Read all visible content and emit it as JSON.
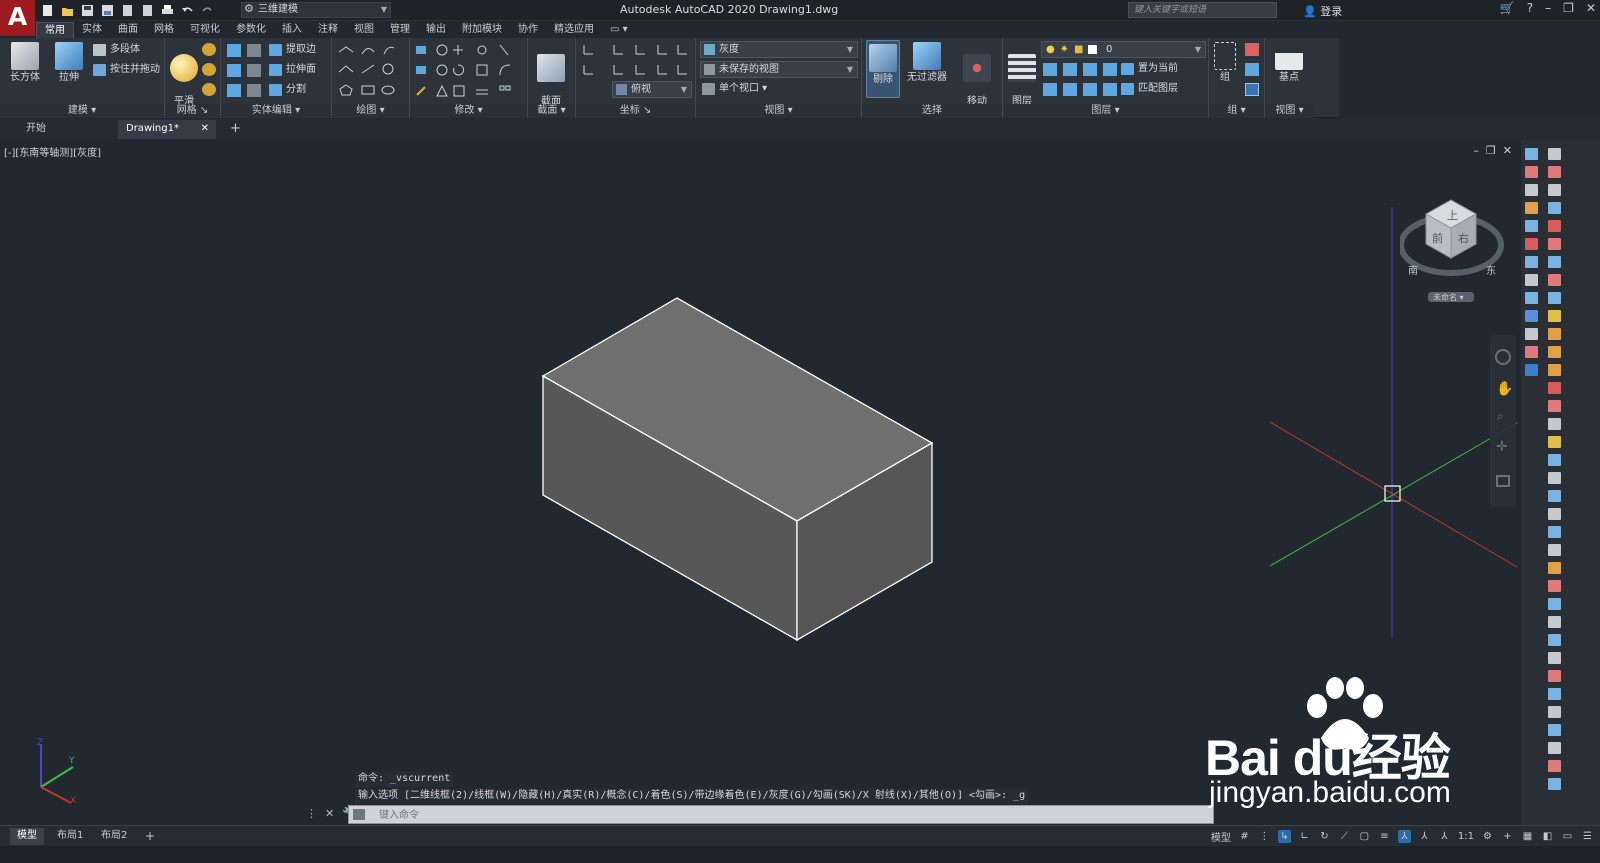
{
  "app": {
    "logo_letter": "A",
    "title": "Autodesk AutoCAD 2020    Drawing1.dwg",
    "workspace": "三维建模",
    "search_placeholder": "键入关键字或短语",
    "login": "登录"
  },
  "ribbon_tabs": [
    "常用",
    "实体",
    "曲面",
    "网格",
    "可视化",
    "参数化",
    "插入",
    "注释",
    "视图",
    "管理",
    "输出",
    "附加模块",
    "协作",
    "精选应用"
  ],
  "ribbon": {
    "modeling": {
      "title": "建模 ▾",
      "box": "长方体",
      "extrude": "拉伸",
      "polysolid": "多段体",
      "presspull": "按住并拖动"
    },
    "mesh": {
      "title": "网格 ↘",
      "smooth": "平滑\n对象"
    },
    "solid_edit": {
      "title": "实体编辑 ▾",
      "extract_edges": "提取边",
      "extrude_faces": "拉伸面",
      "separate": "分割"
    },
    "draw": {
      "title": "绘图 ▾"
    },
    "modify": {
      "title": "修改 ▾"
    },
    "section": {
      "title": "截面 ▾",
      "section_plane": "截面\n平面"
    },
    "coordinates": {
      "title": "坐标 ↘",
      "ucs_dropdown": "俯视"
    },
    "view": {
      "title": "视图 ▾",
      "visual_style": "灰度",
      "saved_view": "未保存的视图",
      "viewport": "单个视口"
    },
    "selection": {
      "title": "选择",
      "culling": "剔除",
      "no_filter": "无过滤器",
      "move_gizmo": "移动\n小控件"
    },
    "layers": {
      "title": "图层 ▾",
      "layer_properties": "图层\n特性",
      "current_layer": "0",
      "set_current": "置为当前",
      "match_layer": "匹配图层"
    },
    "groups": {
      "title": "组 ▾",
      "group": "组"
    },
    "view2": {
      "title": "视图 ▾",
      "base": "基点"
    }
  },
  "doc_tabs": {
    "start": "开始",
    "drawing": "Drawing1*",
    "close": "✕",
    "add": "+"
  },
  "viewport": {
    "label": "[-][东南等轴测][灰度]",
    "viewcube_top": "上",
    "viewcube_front": "前",
    "viewcube_right": "右",
    "viewcube_south": "南",
    "viewcube_east": "东",
    "viewcube_ucs": "未命名 ▾"
  },
  "command": {
    "history": [
      "命令: _vscurrent",
      "输入选项 [二维线框(2)/线框(W)/隐藏(H)/真实(R)/概念(C)/着色(S)/带边缘着色(E)/灰度(G)/勾画(SK)/X 射线(X)/其他(O)] <勾画>: _g"
    ],
    "placeholder": "键入命令"
  },
  "layout_tabs": [
    "模型",
    "布局1",
    "布局2",
    "+"
  ],
  "status": {
    "model": "模型",
    "scale": "1:1"
  },
  "watermark": {
    "brand": "Bai  du经验",
    "url": "jingyan.baidu.com"
  },
  "colors": {
    "accent": "#2d6aa8",
    "logo_red": "#9d1a1e",
    "axis_x": "#c0392b",
    "axis_y": "#3fbf3f",
    "axis_z": "#4a4ac8"
  }
}
